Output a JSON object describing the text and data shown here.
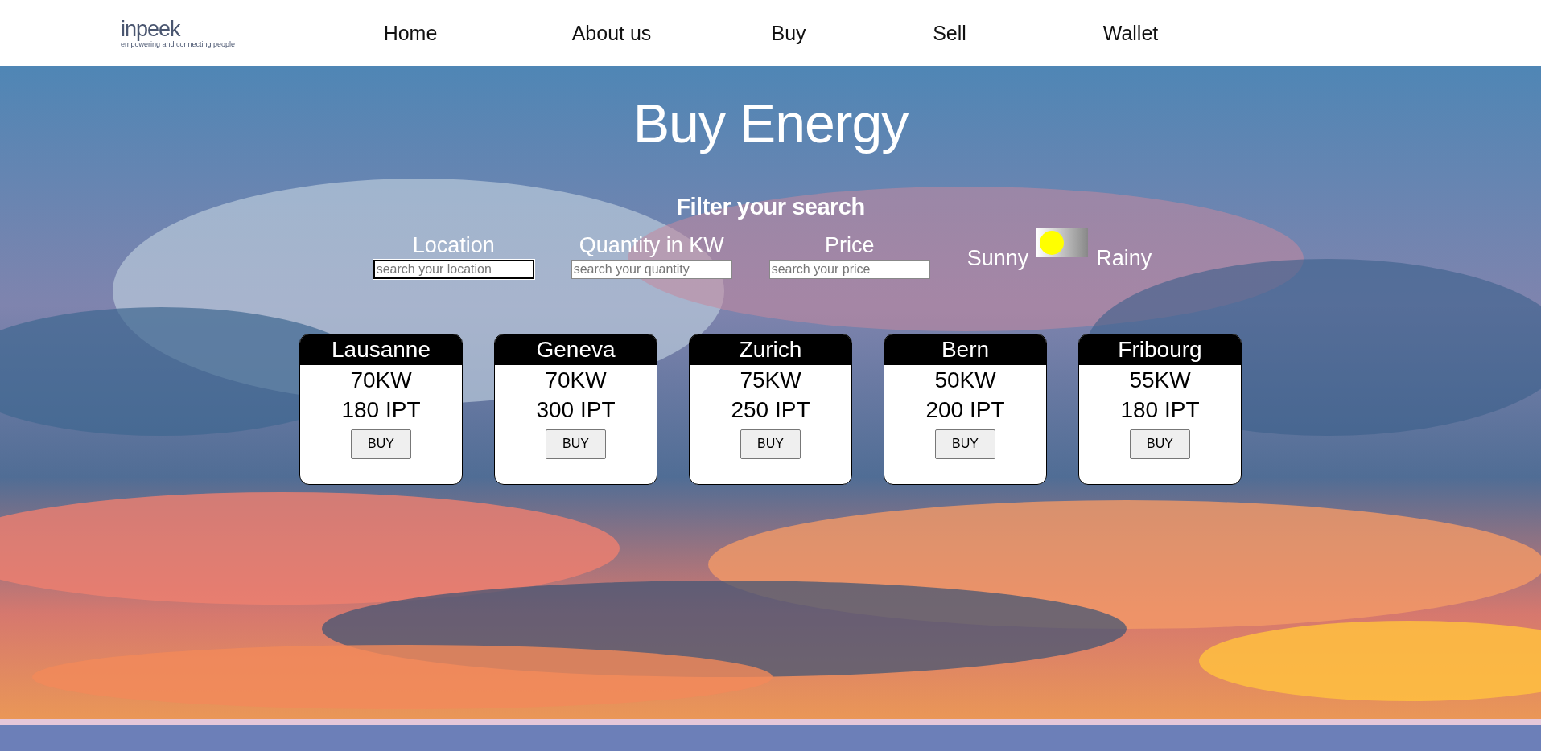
{
  "logo": {
    "name": "inpeek",
    "tagline": "empowering and connecting people"
  },
  "nav": [
    {
      "label": "Home",
      "selected": false
    },
    {
      "label": "About us",
      "selected": false
    },
    {
      "label": "Buy",
      "selected": false
    },
    {
      "label": "Sell",
      "selected": false
    },
    {
      "label": "Wallet",
      "selected": false
    }
  ],
  "title": "Buy Energy",
  "filter": {
    "heading": "Filter your search",
    "fields": [
      {
        "label": "Location",
        "placeholder": "search your location",
        "focused": true
      },
      {
        "label": "Quantity in KW",
        "placeholder": "search your quantity",
        "focused": false
      },
      {
        "label": "Price",
        "placeholder": "search your price",
        "focused": false
      }
    ],
    "weather": {
      "left_label": "Sunny",
      "right_label": "Rainy",
      "rainy": false
    }
  },
  "offers": [
    {
      "city": "Lausanne",
      "quantity": "70KW",
      "price": "180 IPT",
      "button": "BUY"
    },
    {
      "city": "Geneva",
      "quantity": "70KW",
      "price": "300 IPT",
      "button": "BUY"
    },
    {
      "city": "Zurich",
      "quantity": "75KW",
      "price": "250 IPT",
      "button": "BUY"
    },
    {
      "city": "Bern",
      "quantity": "50KW",
      "price": "200 IPT",
      "button": "BUY"
    },
    {
      "city": "Fribourg",
      "quantity": "55KW",
      "price": "180 IPT",
      "button": "BUY"
    }
  ]
}
